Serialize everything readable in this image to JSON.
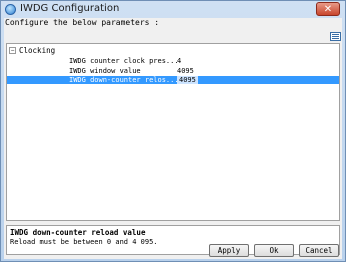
{
  "window": {
    "title": "IWDG Configuration",
    "close_label": "✕"
  },
  "header": {
    "text": "Configure the below parameters :"
  },
  "tree": {
    "group": {
      "expander": "−",
      "label": "Clocking"
    },
    "params": [
      {
        "name": "IWDG counter clock pres...",
        "value": "4"
      },
      {
        "name": "IWDG window value",
        "value": "4095"
      },
      {
        "name": "IWDG down-counter relos...",
        "value": "4095"
      }
    ]
  },
  "description": {
    "title": "IWDG down-counter reload value",
    "body": "Reload must be between 0 and 4 095."
  },
  "buttons": {
    "apply": "Apply",
    "ok": "Ok",
    "cancel": "Cancel"
  }
}
